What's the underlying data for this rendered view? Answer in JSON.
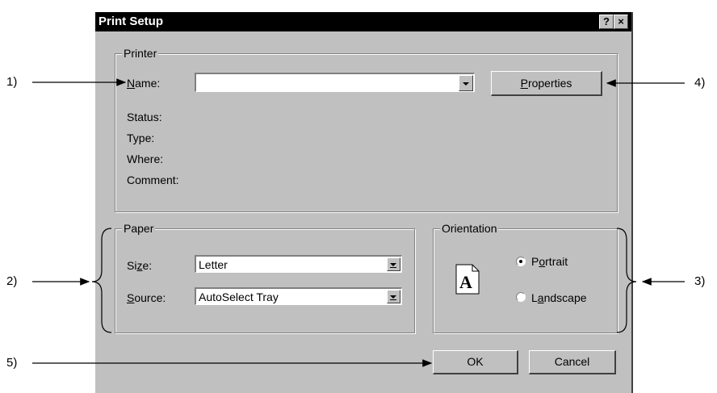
{
  "dialog": {
    "title": "Print Setup",
    "help_button": "?",
    "close_button": "×"
  },
  "printer": {
    "legend": "Printer",
    "name_label_prefix": "",
    "name_label_accel": "N",
    "name_label_rest": "ame:",
    "name_value": "",
    "properties_accel": "P",
    "properties_rest": "roperties",
    "status_label": "Status:",
    "type_label": "Type:",
    "where_label": "Where:",
    "comment_label": "Comment:"
  },
  "paper": {
    "legend": "Paper",
    "size_label_prefix": "Si",
    "size_label_accel": "z",
    "size_label_rest": "e:",
    "size_value": "Letter",
    "source_label_accel": "S",
    "source_label_rest": "ource:",
    "source_value": "AutoSelect Tray"
  },
  "orientation": {
    "legend": "Orientation",
    "icon_letter": "A",
    "portrait_prefix": "P",
    "portrait_accel": "o",
    "portrait_rest": "rtrait",
    "portrait_selected": true,
    "landscape_prefix": "L",
    "landscape_accel": "a",
    "landscape_rest": "ndscape",
    "landscape_selected": false
  },
  "buttons": {
    "ok": "OK",
    "cancel": "Cancel"
  },
  "callouts": {
    "c1": "1)",
    "c2": "2)",
    "c3": "3)",
    "c4": "4)",
    "c5": "5)"
  }
}
